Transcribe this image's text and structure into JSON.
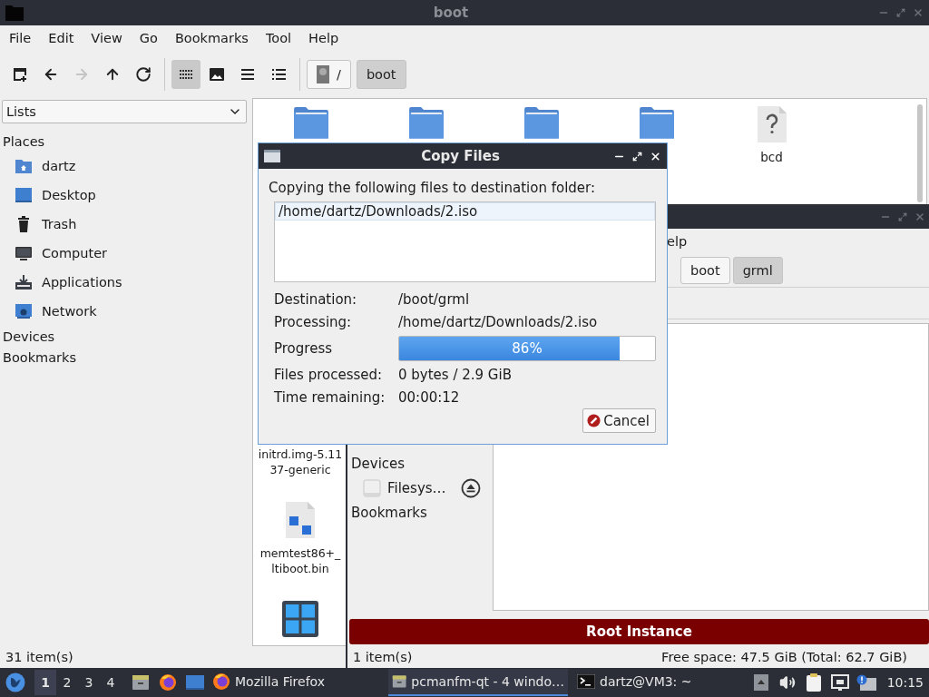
{
  "main_window": {
    "title": "boot",
    "menu": [
      "File",
      "Edit",
      "View",
      "Go",
      "Bookmarks",
      "Tool",
      "Help"
    ],
    "nav_buttons": [
      {
        "kind": "new-tab",
        "disabled": false
      },
      {
        "kind": "back",
        "disabled": false
      },
      {
        "kind": "forward",
        "disabled": true
      },
      {
        "kind": "up",
        "disabled": false
      },
      {
        "kind": "reload",
        "disabled": false
      }
    ],
    "view_modes": [
      {
        "kind": "icons",
        "selected": true
      },
      {
        "kind": "thumbnails",
        "selected": false
      },
      {
        "kind": "compact",
        "selected": false
      },
      {
        "kind": "detailed",
        "selected": false
      }
    ],
    "path": [
      {
        "label": "/",
        "kind": "root",
        "selected": false
      },
      {
        "label": "boot",
        "kind": "folder",
        "selected": true
      }
    ],
    "sidebar": {
      "dropdown": "Lists",
      "sections": [
        {
          "title": "Places",
          "items": [
            {
              "label": "dartz",
              "kind": "home"
            },
            {
              "label": "Desktop",
              "kind": "desktop"
            },
            {
              "label": "Trash",
              "kind": "trash"
            },
            {
              "label": "Computer",
              "kind": "computer"
            },
            {
              "label": "Applications",
              "kind": "applications"
            },
            {
              "label": "Network",
              "kind": "network"
            }
          ]
        },
        {
          "title": "Devices"
        },
        {
          "title": "Bookmarks"
        }
      ]
    },
    "files_top_row": [
      {
        "kind": "folder"
      },
      {
        "kind": "folder"
      },
      {
        "kind": "folder"
      },
      {
        "kind": "folder"
      },
      {
        "kind": "unknown",
        "name_lines": [
          "bcd"
        ]
      }
    ],
    "files_first_column": [
      {
        "name_lines": [
          "initrd.img-5.11",
          "37-generic"
        ]
      },
      {
        "kind": "binary",
        "name_lines": [
          "memtest86+_",
          "ltiboot.bin"
        ]
      },
      {
        "kind": "grid"
      }
    ],
    "status": "31 item(s)"
  },
  "second_window": {
    "menu": [
      "elp"
    ],
    "path": [
      {
        "label": "boot",
        "selected": false
      },
      {
        "label": "grml",
        "selected": true
      }
    ],
    "sidebar": {
      "sections": [
        {
          "title": "Devices",
          "items": [
            {
              "label": "Filesys…",
              "kind": "drive",
              "ejectable": true
            }
          ]
        },
        {
          "title": "Bookmarks"
        }
      ]
    },
    "banner": "Root Instance",
    "status": "1 item(s)",
    "free_space": "Free space: 47.5 GiB (Total: 62.7 GiB)"
  },
  "dialog": {
    "title": "Copy Files",
    "intro": "Copying the following files to destination folder:",
    "files": [
      {
        "path": "/home/dartz/Downloads/2.iso",
        "selected": true
      }
    ],
    "fields": [
      {
        "kind": "text",
        "label": "Destination:",
        "value": "/boot/grml"
      },
      {
        "kind": "text",
        "label": "Processing:",
        "value": "/home/dartz/Downloads/2.iso"
      },
      {
        "kind": "progress",
        "label": "Progress",
        "level": 0.86,
        "reading": "86%"
      },
      {
        "kind": "text",
        "label": "Files processed:",
        "value": "0 bytes / 2.9 GiB"
      },
      {
        "kind": "text",
        "label": "Time remaining:",
        "value": "00:00:12"
      }
    ],
    "buttons": [
      "Cancel"
    ]
  },
  "taskbar": {
    "workspaces": [
      {
        "label": "1",
        "selected": true
      },
      {
        "label": "2",
        "selected": false
      },
      {
        "label": "3",
        "selected": false
      },
      {
        "label": "4",
        "selected": false
      }
    ],
    "launchers": [
      {
        "kind": "files"
      },
      {
        "kind": "browser"
      },
      {
        "kind": "desktop"
      }
    ],
    "tasks": [
      {
        "label": "Mozilla Firefox",
        "kind": "browser",
        "selected": false
      },
      {
        "label": "pcmanfm-qt - 4 windo…",
        "kind": "files",
        "selected": true
      },
      {
        "label": "dartz@VM3: ~",
        "kind": "terminal",
        "selected": false
      }
    ],
    "tray": [
      {
        "kind": "expand"
      },
      {
        "kind": "volume"
      },
      {
        "kind": "clipboard"
      },
      {
        "kind": "network"
      },
      {
        "kind": "notification"
      }
    ],
    "clock": "10:15"
  }
}
